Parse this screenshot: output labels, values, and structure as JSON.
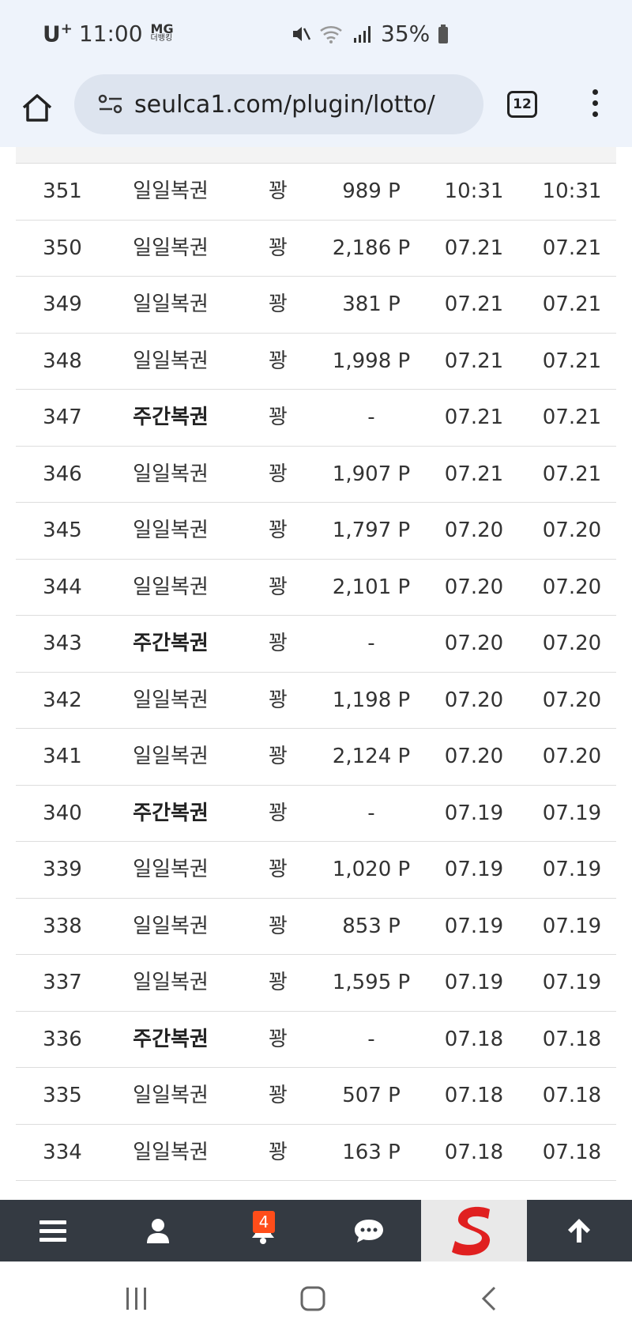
{
  "status_bar": {
    "carrier": "U",
    "carrier_sup": "+",
    "time": "11:00",
    "brand_top": "MG",
    "brand_bottom": "더뱅킹",
    "battery": "35%"
  },
  "browser": {
    "url": "seulca1.com/plugin/lotto/",
    "tab_count": "12"
  },
  "table": {
    "rows": [
      {
        "no": "351",
        "type": "일일복권",
        "bold": false,
        "result": "꽝",
        "points": "989 P",
        "date1": "10:31",
        "date2": "10:31"
      },
      {
        "no": "350",
        "type": "일일복권",
        "bold": false,
        "result": "꽝",
        "points": "2,186 P",
        "date1": "07.21",
        "date2": "07.21"
      },
      {
        "no": "349",
        "type": "일일복권",
        "bold": false,
        "result": "꽝",
        "points": "381 P",
        "date1": "07.21",
        "date2": "07.21"
      },
      {
        "no": "348",
        "type": "일일복권",
        "bold": false,
        "result": "꽝",
        "points": "1,998 P",
        "date1": "07.21",
        "date2": "07.21"
      },
      {
        "no": "347",
        "type": "주간복권",
        "bold": true,
        "result": "꽝",
        "points": "-",
        "date1": "07.21",
        "date2": "07.21"
      },
      {
        "no": "346",
        "type": "일일복권",
        "bold": false,
        "result": "꽝",
        "points": "1,907 P",
        "date1": "07.21",
        "date2": "07.21"
      },
      {
        "no": "345",
        "type": "일일복권",
        "bold": false,
        "result": "꽝",
        "points": "1,797 P",
        "date1": "07.20",
        "date2": "07.20"
      },
      {
        "no": "344",
        "type": "일일복권",
        "bold": false,
        "result": "꽝",
        "points": "2,101 P",
        "date1": "07.20",
        "date2": "07.20"
      },
      {
        "no": "343",
        "type": "주간복권",
        "bold": true,
        "result": "꽝",
        "points": "-",
        "date1": "07.20",
        "date2": "07.20"
      },
      {
        "no": "342",
        "type": "일일복권",
        "bold": false,
        "result": "꽝",
        "points": "1,198 P",
        "date1": "07.20",
        "date2": "07.20"
      },
      {
        "no": "341",
        "type": "일일복권",
        "bold": false,
        "result": "꽝",
        "points": "2,124 P",
        "date1": "07.20",
        "date2": "07.20"
      },
      {
        "no": "340",
        "type": "주간복권",
        "bold": true,
        "result": "꽝",
        "points": "-",
        "date1": "07.19",
        "date2": "07.19"
      },
      {
        "no": "339",
        "type": "일일복권",
        "bold": false,
        "result": "꽝",
        "points": "1,020 P",
        "date1": "07.19",
        "date2": "07.19"
      },
      {
        "no": "338",
        "type": "일일복권",
        "bold": false,
        "result": "꽝",
        "points": "853 P",
        "date1": "07.19",
        "date2": "07.19"
      },
      {
        "no": "337",
        "type": "일일복권",
        "bold": false,
        "result": "꽝",
        "points": "1,595 P",
        "date1": "07.19",
        "date2": "07.19"
      },
      {
        "no": "336",
        "type": "주간복권",
        "bold": true,
        "result": "꽝",
        "points": "-",
        "date1": "07.18",
        "date2": "07.18"
      },
      {
        "no": "335",
        "type": "일일복권",
        "bold": false,
        "result": "꽝",
        "points": "507 P",
        "date1": "07.18",
        "date2": "07.18"
      },
      {
        "no": "334",
        "type": "일일복권",
        "bold": false,
        "result": "꽝",
        "points": "163 P",
        "date1": "07.18",
        "date2": "07.18"
      }
    ]
  },
  "bottom_nav": {
    "notification_count": "4",
    "items": [
      "menu-icon",
      "user-icon",
      "bell-icon",
      "chat-icon",
      "site-logo",
      "arrow-up-icon"
    ]
  },
  "colors": {
    "status_bg": "#eef3fb",
    "nav_bg": "#343a42",
    "badge": "#ff4d1a",
    "logo_red": "#e02020"
  }
}
